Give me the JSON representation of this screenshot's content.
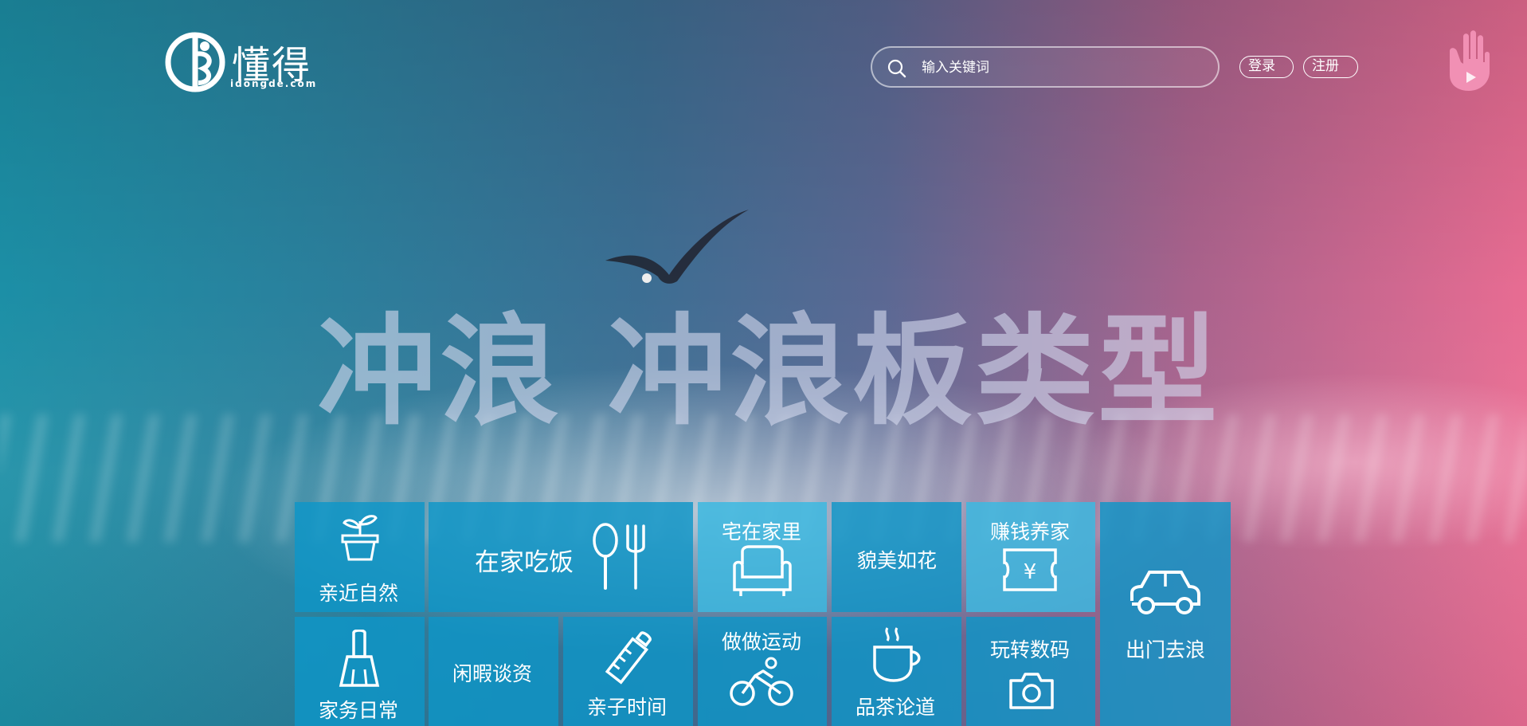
{
  "brand": {
    "name": "懂得",
    "domain": "idongde.com"
  },
  "search": {
    "placeholder": "输入关键词"
  },
  "auth": {
    "login": "登录",
    "register": "注册"
  },
  "hero": {
    "headline": "冲浪 冲浪板类型"
  },
  "categories": {
    "nature": "亲近自然",
    "cooking": "在家吃饭",
    "home": "宅在家里",
    "beauty": "貌美如花",
    "earn": "赚钱养家",
    "outing": "出门去浪",
    "chores": "家务日常",
    "leisure": "闲暇谈资",
    "parenting": "亲子时间",
    "sports": "做做运动",
    "tea": "品茶论道",
    "digital": "玩转数码"
  },
  "colors": {
    "tile": "#0e96c8",
    "accent_pink": "#e86c92",
    "accent_teal": "#1c8fa6"
  }
}
